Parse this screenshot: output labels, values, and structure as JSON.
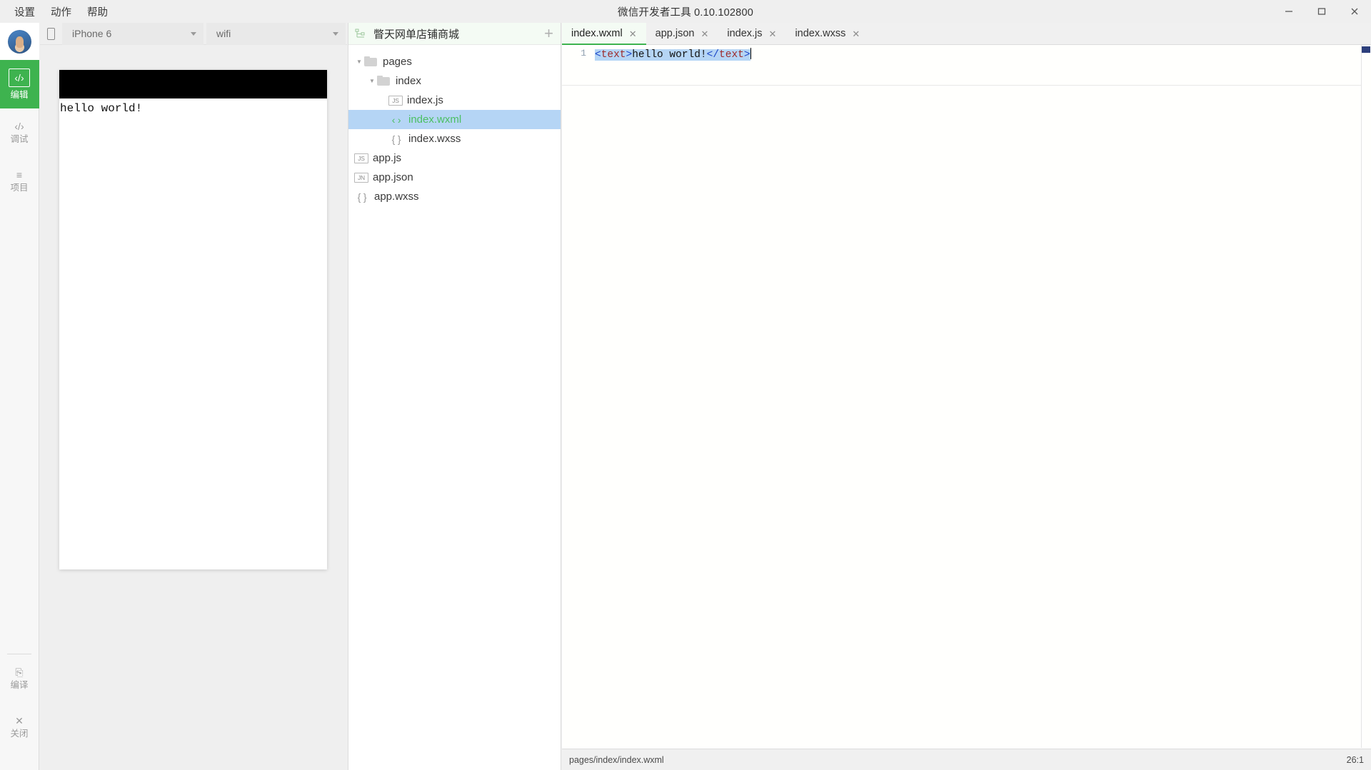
{
  "window": {
    "title": "微信开发者工具 0.10.102800",
    "controls": {
      "minimize": "minimize-icon",
      "maximize": "maximize-icon",
      "close": "close-icon"
    }
  },
  "menubar": {
    "items": [
      {
        "label": "设置"
      },
      {
        "label": "动作"
      },
      {
        "label": "帮助"
      }
    ]
  },
  "rail": {
    "items": [
      {
        "glyph": "‹/›",
        "label": "编辑",
        "active": true
      },
      {
        "glyph": "‹/›",
        "label": "调试",
        "active": false
      },
      {
        "glyph": "≡",
        "label": "项目",
        "active": false
      }
    ],
    "bottom": [
      {
        "glyph": "⎘",
        "label": "编译"
      },
      {
        "glyph": "✕",
        "label": "关闭"
      }
    ],
    "accent": "#3eb34f"
  },
  "simulator": {
    "device_icon": "phone-icon",
    "device": "iPhone 6",
    "network": "wifi",
    "preview_text": "hello world!"
  },
  "tree": {
    "project_icon": "project-structure-icon",
    "project_name": "瞥天网单店铺商城",
    "add_label": "+",
    "nodes": [
      {
        "label": "pages",
        "type": "folder",
        "depth": 0,
        "expanded": true,
        "selected": false
      },
      {
        "label": "index",
        "type": "folder",
        "depth": 1,
        "expanded": true,
        "selected": false
      },
      {
        "label": "index.js",
        "type": "js",
        "depth": 2,
        "selected": false
      },
      {
        "label": "index.wxml",
        "type": "wxml",
        "depth": 2,
        "selected": true
      },
      {
        "label": "index.wxss",
        "type": "wxss",
        "depth": 2,
        "selected": false
      },
      {
        "label": "app.js",
        "type": "js",
        "depth": 0,
        "selected": false
      },
      {
        "label": "app.json",
        "type": "json",
        "depth": 0,
        "selected": false
      },
      {
        "label": "app.wxss",
        "type": "wxss",
        "depth": 0,
        "selected": false
      }
    ],
    "icon_text": {
      "js": "JS",
      "json": "JN",
      "wxss": "{ }",
      "wxml": "‹ ›"
    }
  },
  "editor": {
    "tabs": [
      {
        "label": "index.wxml",
        "active": true
      },
      {
        "label": "app.json",
        "active": false
      },
      {
        "label": "index.js",
        "active": false
      },
      {
        "label": "index.wxss",
        "active": false
      }
    ],
    "close_glyph": "✕",
    "line_number": "1",
    "code": {
      "open_lt": "<",
      "open_tag": "text",
      "open_gt": ">",
      "text": "hello world!",
      "close_lt": "</",
      "close_tag": "text",
      "close_gt": ">"
    },
    "status": {
      "path": "pages/index/index.wxml",
      "position": "26:1"
    }
  },
  "colors": {
    "accent_green": "#3eb34f",
    "tag_maroon": "#9d2b2b",
    "bracket_blue": "#1a46c8",
    "selection_blue": "#b5d5f5",
    "panel_grey": "#efefef"
  }
}
